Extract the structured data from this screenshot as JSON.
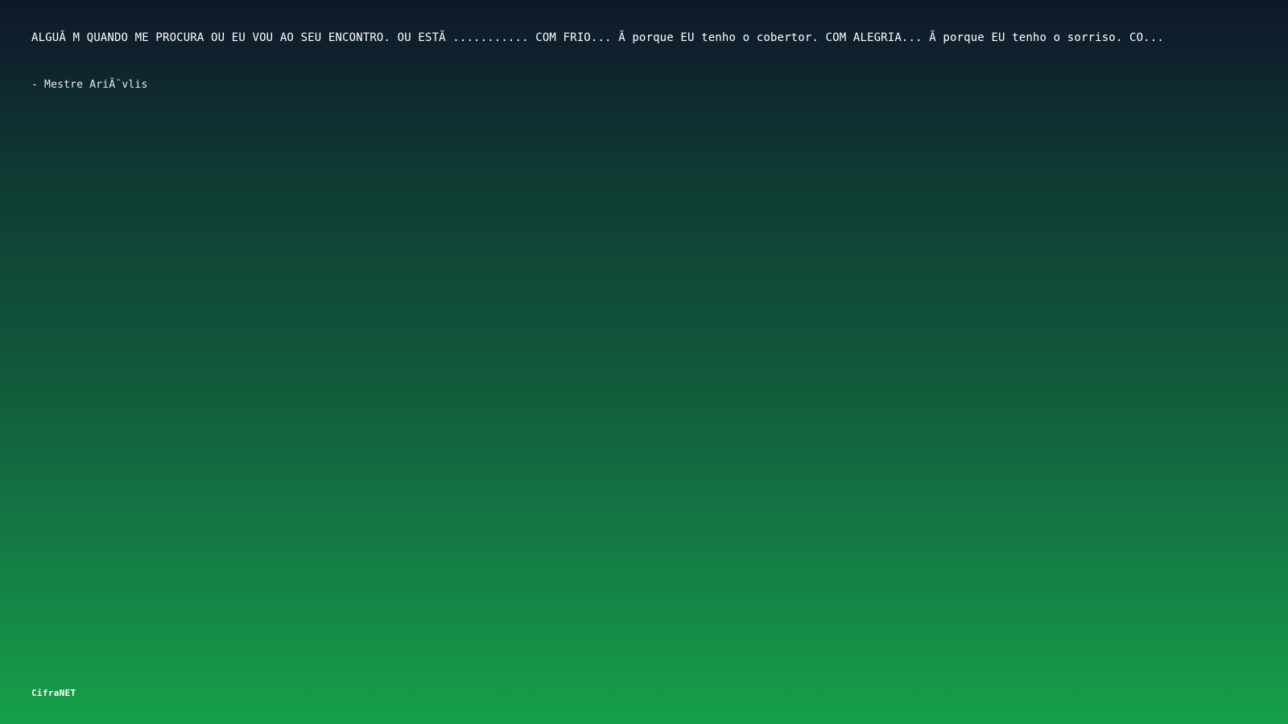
{
  "quote": {
    "text": "ALGUĂ M QUANDO ME PROCURA OU EU VOU AO SEU ENCONTRO. OU ESTĂ ........... COM FRIO... Ă  porque EU tenho o cobertor. COM ALEGRIA... Ă  porque EU tenho o sorriso. CO...",
    "author": "- Mestre AriĂ¨vlis"
  },
  "brand": {
    "name": "CifraNET"
  },
  "colors": {
    "gradient_top": "#0f172a",
    "gradient_bottom": "#169f49",
    "text": "#ffffff"
  }
}
